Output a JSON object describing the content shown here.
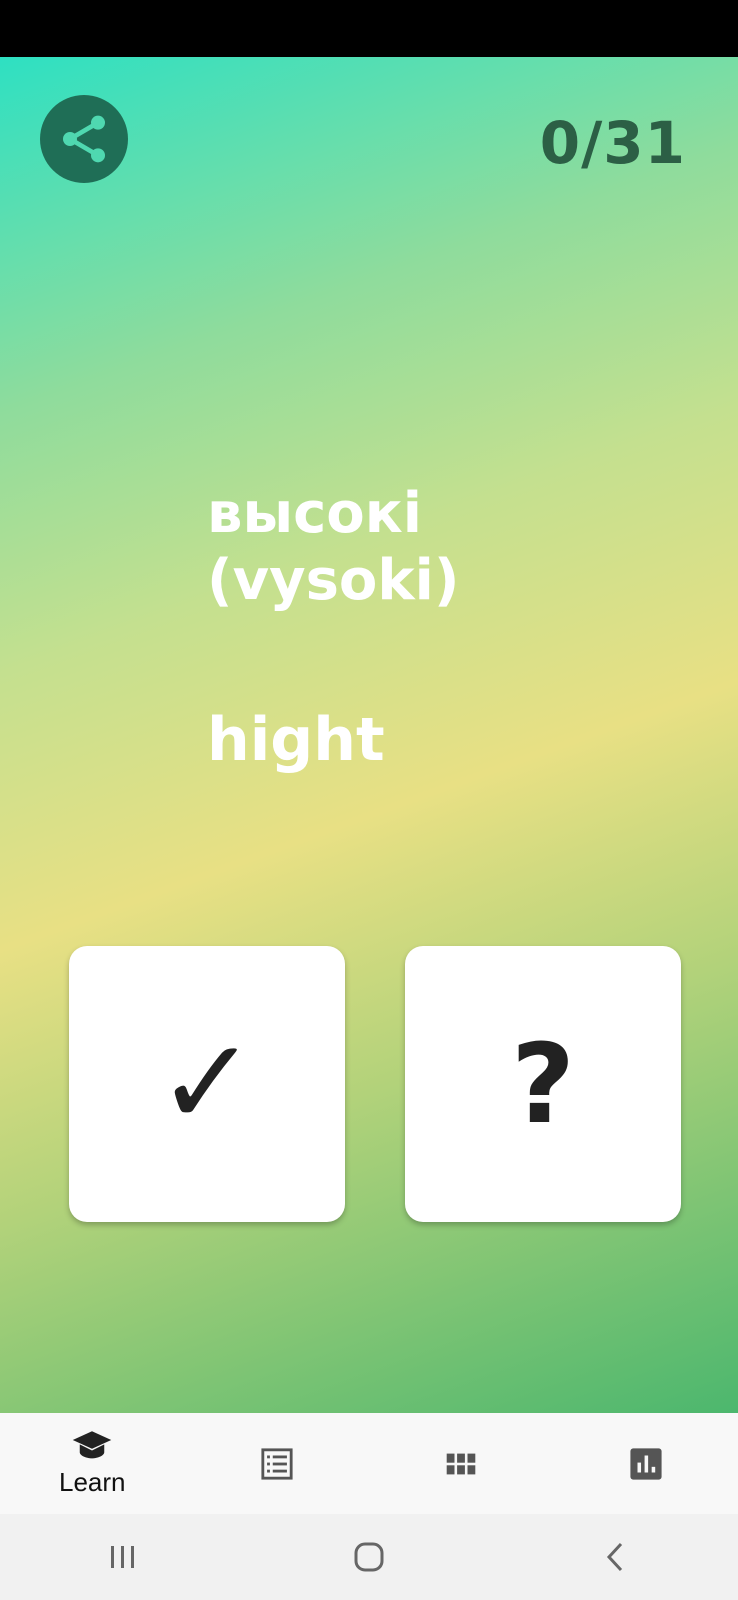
{
  "progress": {
    "counter": "0/31"
  },
  "card": {
    "word_native": "высокі",
    "word_translit": "(vysoki)",
    "translation": "hight"
  },
  "buttons": {
    "know_glyph": "✓",
    "unknown_glyph": "?"
  },
  "bottom_nav": {
    "items": [
      {
        "icon": "graduation-cap-icon",
        "label": "Learn",
        "active": true
      },
      {
        "icon": "list-icon",
        "label": ""
      },
      {
        "icon": "grid-icon",
        "label": ""
      },
      {
        "icon": "bar-chart-icon",
        "label": ""
      }
    ]
  },
  "colors": {
    "share_bg": "#1f6e56",
    "counter": "#2c5f45",
    "nav_icon": "#555555"
  }
}
